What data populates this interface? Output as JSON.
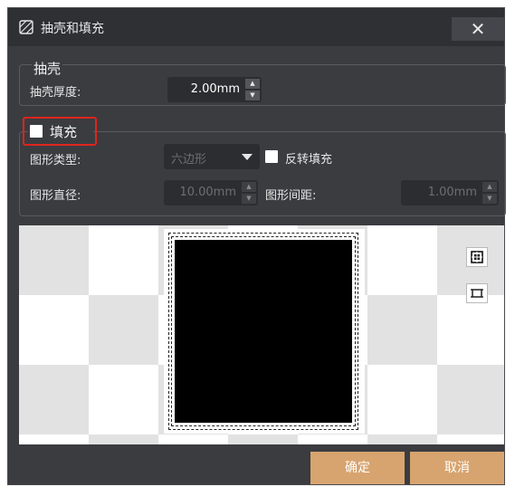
{
  "window": {
    "title": "抽壳和填充",
    "close_glyph": "✕"
  },
  "shell": {
    "title": "抽壳",
    "thickness_label": "抽壳厚度:",
    "thickness_value": "2.00mm"
  },
  "fill": {
    "title": "填充",
    "checked": false,
    "shape_type_label": "图形类型:",
    "shape_type_value": "六边形",
    "invert_label": "反转填充",
    "diameter_label": "图形直径:",
    "diameter_value": "10.00mm",
    "spacing_label": "图形间距:",
    "spacing_value": "1.00mm"
  },
  "preview": {
    "fit_icon": "fit-view-icon",
    "frame_icon": "frame-icon"
  },
  "buttons": {
    "confirm": "确定",
    "cancel": "取消"
  },
  "colors": {
    "accent": "#d7a46f",
    "highlight": "#e0241c",
    "dialog_bg": "#3b3c40"
  }
}
